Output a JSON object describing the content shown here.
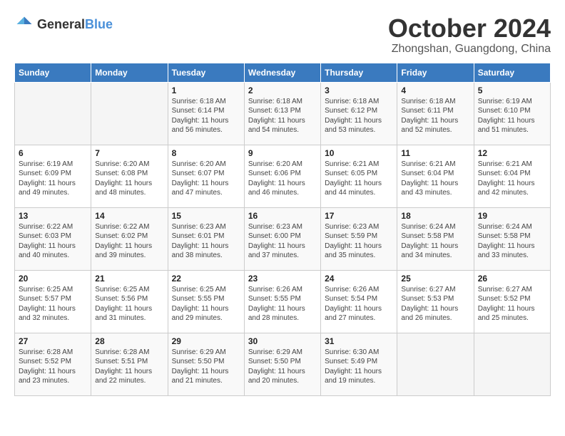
{
  "header": {
    "logo_general": "General",
    "logo_blue": "Blue",
    "month_title": "October 2024",
    "location": "Zhongshan, Guangdong, China"
  },
  "weekdays": [
    "Sunday",
    "Monday",
    "Tuesday",
    "Wednesday",
    "Thursday",
    "Friday",
    "Saturday"
  ],
  "weeks": [
    [
      {
        "day": "",
        "info": ""
      },
      {
        "day": "",
        "info": ""
      },
      {
        "day": "1",
        "info": "Sunrise: 6:18 AM\nSunset: 6:14 PM\nDaylight: 11 hours and 56 minutes."
      },
      {
        "day": "2",
        "info": "Sunrise: 6:18 AM\nSunset: 6:13 PM\nDaylight: 11 hours and 54 minutes."
      },
      {
        "day": "3",
        "info": "Sunrise: 6:18 AM\nSunset: 6:12 PM\nDaylight: 11 hours and 53 minutes."
      },
      {
        "day": "4",
        "info": "Sunrise: 6:18 AM\nSunset: 6:11 PM\nDaylight: 11 hours and 52 minutes."
      },
      {
        "day": "5",
        "info": "Sunrise: 6:19 AM\nSunset: 6:10 PM\nDaylight: 11 hours and 51 minutes."
      }
    ],
    [
      {
        "day": "6",
        "info": "Sunrise: 6:19 AM\nSunset: 6:09 PM\nDaylight: 11 hours and 49 minutes."
      },
      {
        "day": "7",
        "info": "Sunrise: 6:20 AM\nSunset: 6:08 PM\nDaylight: 11 hours and 48 minutes."
      },
      {
        "day": "8",
        "info": "Sunrise: 6:20 AM\nSunset: 6:07 PM\nDaylight: 11 hours and 47 minutes."
      },
      {
        "day": "9",
        "info": "Sunrise: 6:20 AM\nSunset: 6:06 PM\nDaylight: 11 hours and 46 minutes."
      },
      {
        "day": "10",
        "info": "Sunrise: 6:21 AM\nSunset: 6:05 PM\nDaylight: 11 hours and 44 minutes."
      },
      {
        "day": "11",
        "info": "Sunrise: 6:21 AM\nSunset: 6:04 PM\nDaylight: 11 hours and 43 minutes."
      },
      {
        "day": "12",
        "info": "Sunrise: 6:21 AM\nSunset: 6:04 PM\nDaylight: 11 hours and 42 minutes."
      }
    ],
    [
      {
        "day": "13",
        "info": "Sunrise: 6:22 AM\nSunset: 6:03 PM\nDaylight: 11 hours and 40 minutes."
      },
      {
        "day": "14",
        "info": "Sunrise: 6:22 AM\nSunset: 6:02 PM\nDaylight: 11 hours and 39 minutes."
      },
      {
        "day": "15",
        "info": "Sunrise: 6:23 AM\nSunset: 6:01 PM\nDaylight: 11 hours and 38 minutes."
      },
      {
        "day": "16",
        "info": "Sunrise: 6:23 AM\nSunset: 6:00 PM\nDaylight: 11 hours and 37 minutes."
      },
      {
        "day": "17",
        "info": "Sunrise: 6:23 AM\nSunset: 5:59 PM\nDaylight: 11 hours and 35 minutes."
      },
      {
        "day": "18",
        "info": "Sunrise: 6:24 AM\nSunset: 5:58 PM\nDaylight: 11 hours and 34 minutes."
      },
      {
        "day": "19",
        "info": "Sunrise: 6:24 AM\nSunset: 5:58 PM\nDaylight: 11 hours and 33 minutes."
      }
    ],
    [
      {
        "day": "20",
        "info": "Sunrise: 6:25 AM\nSunset: 5:57 PM\nDaylight: 11 hours and 32 minutes."
      },
      {
        "day": "21",
        "info": "Sunrise: 6:25 AM\nSunset: 5:56 PM\nDaylight: 11 hours and 31 minutes."
      },
      {
        "day": "22",
        "info": "Sunrise: 6:25 AM\nSunset: 5:55 PM\nDaylight: 11 hours and 29 minutes."
      },
      {
        "day": "23",
        "info": "Sunrise: 6:26 AM\nSunset: 5:55 PM\nDaylight: 11 hours and 28 minutes."
      },
      {
        "day": "24",
        "info": "Sunrise: 6:26 AM\nSunset: 5:54 PM\nDaylight: 11 hours and 27 minutes."
      },
      {
        "day": "25",
        "info": "Sunrise: 6:27 AM\nSunset: 5:53 PM\nDaylight: 11 hours and 26 minutes."
      },
      {
        "day": "26",
        "info": "Sunrise: 6:27 AM\nSunset: 5:52 PM\nDaylight: 11 hours and 25 minutes."
      }
    ],
    [
      {
        "day": "27",
        "info": "Sunrise: 6:28 AM\nSunset: 5:52 PM\nDaylight: 11 hours and 23 minutes."
      },
      {
        "day": "28",
        "info": "Sunrise: 6:28 AM\nSunset: 5:51 PM\nDaylight: 11 hours and 22 minutes."
      },
      {
        "day": "29",
        "info": "Sunrise: 6:29 AM\nSunset: 5:50 PM\nDaylight: 11 hours and 21 minutes."
      },
      {
        "day": "30",
        "info": "Sunrise: 6:29 AM\nSunset: 5:50 PM\nDaylight: 11 hours and 20 minutes."
      },
      {
        "day": "31",
        "info": "Sunrise: 6:30 AM\nSunset: 5:49 PM\nDaylight: 11 hours and 19 minutes."
      },
      {
        "day": "",
        "info": ""
      },
      {
        "day": "",
        "info": ""
      }
    ]
  ]
}
